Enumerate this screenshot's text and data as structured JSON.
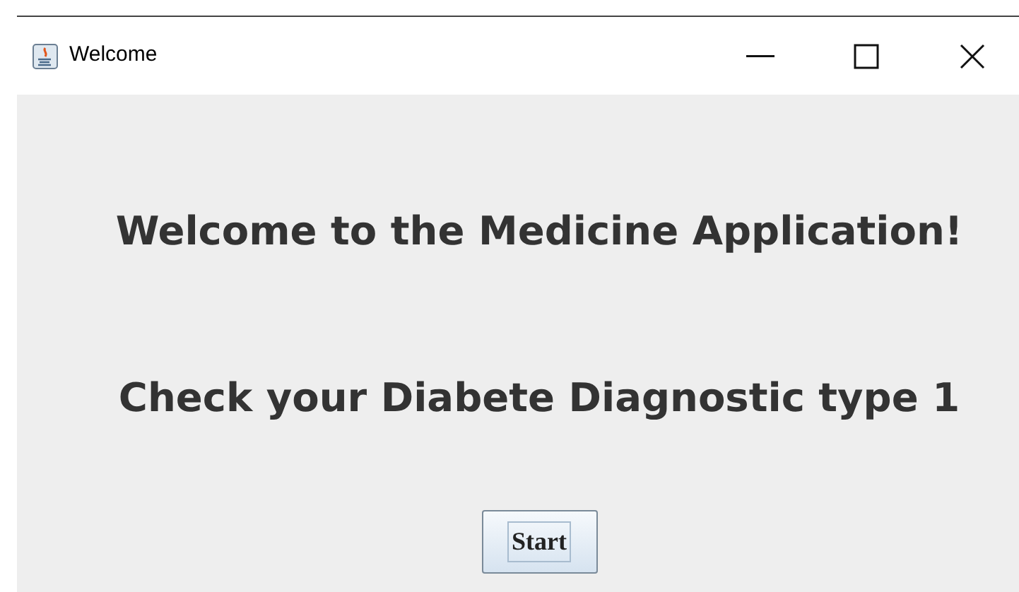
{
  "window": {
    "title": "Welcome"
  },
  "headings": [
    "Welcome to the Medicine Application!",
    "Check your Diabete Diagnostic type 1"
  ],
  "buttons": [
    {
      "label": "Start",
      "focused": true
    }
  ]
}
